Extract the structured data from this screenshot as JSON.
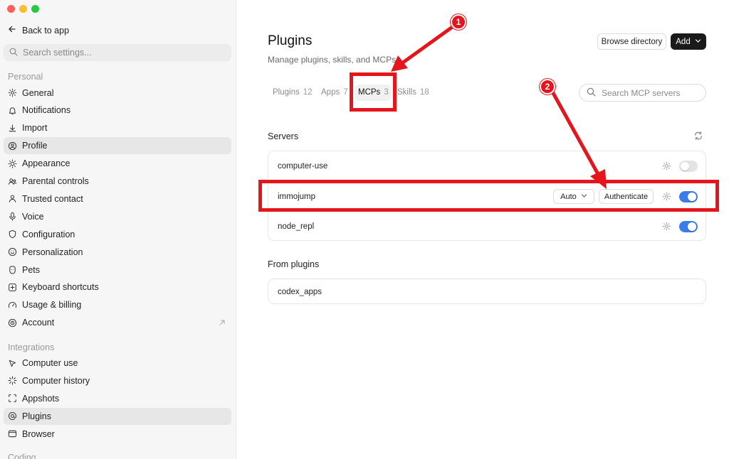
{
  "sidebar": {
    "back_label": "Back to app",
    "search_placeholder": "Search settings...",
    "personal_label": "Personal",
    "personal_items": [
      {
        "label": "General",
        "icon": "gear-icon"
      },
      {
        "label": "Notifications",
        "icon": "bell-icon"
      },
      {
        "label": "Import",
        "icon": "download-icon"
      },
      {
        "label": "Profile",
        "icon": "user-circle-icon",
        "active": true
      },
      {
        "label": "Appearance",
        "icon": "sun-icon"
      },
      {
        "label": "Parental controls",
        "icon": "users-icon"
      },
      {
        "label": "Trusted contact",
        "icon": "person-icon"
      },
      {
        "label": "Voice",
        "icon": "microphone-icon"
      },
      {
        "label": "Configuration",
        "icon": "shield-icon"
      },
      {
        "label": "Personalization",
        "icon": "smile-icon"
      },
      {
        "label": "Pets",
        "icon": "pet-icon"
      },
      {
        "label": "Keyboard shortcuts",
        "icon": "plus-square-icon"
      },
      {
        "label": "Usage & billing",
        "icon": "gauge-icon"
      },
      {
        "label": "Account",
        "icon": "globe-icon"
      }
    ],
    "integrations_label": "Integrations",
    "integration_items": [
      {
        "label": "Computer use",
        "icon": "cursor-icon"
      },
      {
        "label": "Computer history",
        "icon": "sparkle-icon"
      },
      {
        "label": "Appshots",
        "icon": "screenshot-icon"
      },
      {
        "label": "Plugins",
        "icon": "at-icon",
        "active": true
      },
      {
        "label": "Browser",
        "icon": "browser-icon"
      }
    ],
    "coding_label": "Coding"
  },
  "main": {
    "title": "Plugins",
    "subtitle": "Manage plugins, skills, and MCPs",
    "browse_label": "Browse directory",
    "add_label": "Add",
    "tabs": [
      {
        "label": "Plugins",
        "count": "12"
      },
      {
        "label": "Apps",
        "count": "7"
      },
      {
        "label": "MCPs",
        "count": "3",
        "active": true
      },
      {
        "label": "Skills",
        "count": "18"
      }
    ],
    "search_placeholder": "Search MCP servers",
    "servers_label": "Servers",
    "servers": [
      {
        "name": "computer-use",
        "enabled": false
      },
      {
        "name": "immojump",
        "enabled": true,
        "mode": "Auto",
        "action": "Authenticate"
      },
      {
        "name": "node_repl",
        "enabled": true
      }
    ],
    "from_plugins_label": "From plugins",
    "from_plugins": [
      {
        "name": "codex_apps"
      }
    ]
  },
  "annotations": [
    {
      "number": "1"
    },
    {
      "number": "2"
    }
  ],
  "colors": {
    "annotation_red": "#e4151c",
    "toggle_on": "#3b7ced",
    "add_button": "#1a1a1a"
  }
}
